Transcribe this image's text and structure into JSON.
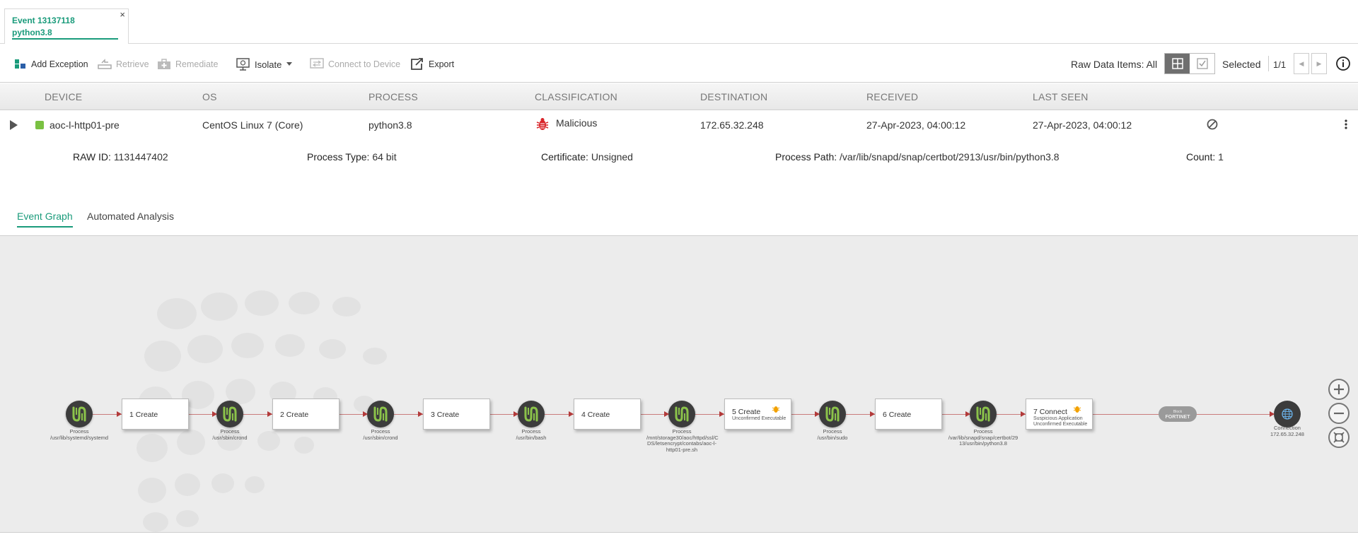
{
  "tab": {
    "line1": "Event 13137118",
    "line2": "python3.8",
    "close": "×"
  },
  "toolbar": {
    "add_exception": "Add Exception",
    "retrieve": "Retrieve",
    "remediate": "Remediate",
    "isolate": "Isolate",
    "connect": "Connect to Device",
    "export": "Export",
    "raw_data": "Raw Data Items: All",
    "selected": "Selected",
    "count": "1/1"
  },
  "table": {
    "headers": [
      "DEVICE",
      "OS",
      "PROCESS",
      "CLASSIFICATION",
      "DESTINATION",
      "RECEIVED",
      "LAST SEEN"
    ],
    "row": {
      "device": "aoc-l-http01-pre",
      "os": "CentOS Linux 7 (Core)",
      "process": "python3.8",
      "classification": "Malicious",
      "destination": "172.65.32.248",
      "received": "27-Apr-2023, 04:00:12",
      "last_seen": "27-Apr-2023, 04:00:12"
    }
  },
  "details": {
    "raw_id_label": "RAW ID:",
    "raw_id": "1131447402",
    "ptype_label": "Process Type:",
    "ptype": "64 bit",
    "cert_label": "Certificate:",
    "cert": "Unsigned",
    "path_label": "Process Path:",
    "path": "/var/lib/snapd/snap/certbot/2913/usr/bin/python3.8",
    "count_label": "Count:",
    "count": "1"
  },
  "subtabs": [
    "Event Graph",
    "Automated Analysis"
  ],
  "graph": {
    "processes": [
      {
        "title": "Process",
        "path": "/usr/lib/systemd/systemd"
      },
      {
        "title": "Process",
        "path": "/usr/sbin/crond"
      },
      {
        "title": "Process",
        "path": "/usr/sbin/crond"
      },
      {
        "title": "Process",
        "path": "/usr/bin/bash"
      },
      {
        "title": "Process",
        "path": "/mnt/storage30/aoc/httpd/ssl/C DS/letsencrypt/contabs/aoc-l-http01-pre.sh"
      },
      {
        "title": "Process",
        "path": "/usr/bin/sudo"
      },
      {
        "title": "Process",
        "path": "/var/lib/snapd/snap/certbot/29 13/usr/bin/python3.8"
      }
    ],
    "actions": [
      {
        "label": "1 Create",
        "sub": ""
      },
      {
        "label": "2 Create",
        "sub": ""
      },
      {
        "label": "3 Create",
        "sub": ""
      },
      {
        "label": "4 Create",
        "sub": ""
      },
      {
        "label": "5 Create",
        "sub": "Unconfirmed Executable"
      },
      {
        "label": "6 Create",
        "sub": ""
      },
      {
        "label": "7 Connect",
        "sub": "Suspicious Application Unconfirmed Executable"
      }
    ],
    "block_label": "Block",
    "fortinet": "FORTINET",
    "connection_title": "Connection",
    "connection_ip": "172.65.32.248"
  },
  "colors": {
    "accent": "#1a9b7b",
    "device_status": "#7ac142",
    "malicious": "#d9262b",
    "warning": "#f2a100"
  }
}
